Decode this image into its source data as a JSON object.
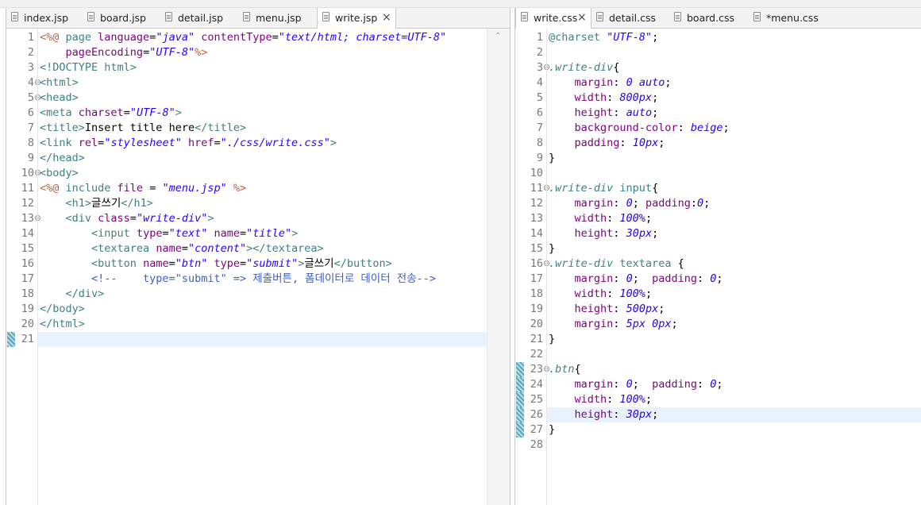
{
  "left": {
    "tabs": [
      {
        "label": "index.jsp",
        "active": false
      },
      {
        "label": "board.jsp",
        "active": false
      },
      {
        "label": "detail.jsp",
        "active": false
      },
      {
        "label": "menu.jsp",
        "active": false
      },
      {
        "label": "write.jsp",
        "active": true,
        "close": "×"
      }
    ],
    "lines": [
      {
        "n": "1",
        "fold": false,
        "segs": [
          [
            "k-jsp",
            "<%@ "
          ],
          [
            "k-tag",
            "page "
          ],
          [
            "k-attr",
            "language"
          ],
          [
            "k-punc",
            "="
          ],
          [
            "k-val",
            "\"java\""
          ],
          [
            "k-punc",
            " "
          ],
          [
            "k-attr",
            "contentType"
          ],
          [
            "k-punc",
            "="
          ],
          [
            "k-val",
            "\"text/html; charset=UTF-8\""
          ]
        ]
      },
      {
        "n": "2",
        "fold": false,
        "segs": [
          [
            "k-punc",
            "    "
          ],
          [
            "k-attr",
            "pageEncoding"
          ],
          [
            "k-punc",
            "="
          ],
          [
            "k-val",
            "\"UTF-8\""
          ],
          [
            "k-jsp",
            "%>"
          ]
        ]
      },
      {
        "n": "3",
        "fold": false,
        "segs": [
          [
            "k-tag",
            "<!DOCTYPE html>"
          ]
        ]
      },
      {
        "n": "4",
        "fold": true,
        "segs": [
          [
            "k-tag",
            "<html>"
          ]
        ]
      },
      {
        "n": "5",
        "fold": true,
        "segs": [
          [
            "k-tag",
            "<head>"
          ]
        ]
      },
      {
        "n": "6",
        "fold": false,
        "segs": [
          [
            "k-tag",
            "<meta "
          ],
          [
            "k-attr",
            "charset"
          ],
          [
            "k-punc",
            "="
          ],
          [
            "k-val",
            "\"UTF-8\""
          ],
          [
            "k-tag",
            ">"
          ]
        ]
      },
      {
        "n": "7",
        "fold": false,
        "segs": [
          [
            "k-tag",
            "<title>"
          ],
          [
            "k-punc",
            "Insert title here"
          ],
          [
            "k-tag",
            "</title>"
          ]
        ]
      },
      {
        "n": "8",
        "fold": false,
        "segs": [
          [
            "k-tag",
            "<link "
          ],
          [
            "k-attr",
            "rel"
          ],
          [
            "k-punc",
            "="
          ],
          [
            "k-val",
            "\"stylesheet\""
          ],
          [
            "k-punc",
            " "
          ],
          [
            "k-attr",
            "href"
          ],
          [
            "k-punc",
            "="
          ],
          [
            "k-val",
            "\"./css/write.css\""
          ],
          [
            "k-tag",
            ">"
          ]
        ]
      },
      {
        "n": "9",
        "fold": false,
        "segs": [
          [
            "k-tag",
            "</head>"
          ]
        ]
      },
      {
        "n": "10",
        "fold": true,
        "segs": [
          [
            "k-tag",
            "<body>"
          ]
        ]
      },
      {
        "n": "11",
        "fold": false,
        "segs": [
          [
            "k-jsp",
            "<%@ "
          ],
          [
            "k-tag",
            "include "
          ],
          [
            "k-attr",
            "file"
          ],
          [
            "k-punc",
            " = "
          ],
          [
            "k-val",
            "\"menu.jsp\""
          ],
          [
            "k-punc",
            " "
          ],
          [
            "k-jsp",
            "%>"
          ]
        ]
      },
      {
        "n": "12",
        "fold": false,
        "segs": [
          [
            "k-punc",
            "    "
          ],
          [
            "k-tag",
            "<h1>"
          ],
          [
            "k-punc",
            "글쓰기"
          ],
          [
            "k-tag",
            "</h1>"
          ]
        ]
      },
      {
        "n": "13",
        "fold": true,
        "segs": [
          [
            "k-punc",
            "    "
          ],
          [
            "k-tag",
            "<div "
          ],
          [
            "k-attr",
            "class"
          ],
          [
            "k-punc",
            "="
          ],
          [
            "k-val",
            "\"write-div\""
          ],
          [
            "k-tag",
            ">"
          ]
        ]
      },
      {
        "n": "14",
        "fold": false,
        "segs": [
          [
            "k-punc",
            "        "
          ],
          [
            "k-tag",
            "<input "
          ],
          [
            "k-attr",
            "type"
          ],
          [
            "k-punc",
            "="
          ],
          [
            "k-val",
            "\"text\""
          ],
          [
            "k-punc",
            " "
          ],
          [
            "k-attr",
            "name"
          ],
          [
            "k-punc",
            "="
          ],
          [
            "k-val",
            "\"title\""
          ],
          [
            "k-tag",
            ">"
          ]
        ]
      },
      {
        "n": "15",
        "fold": false,
        "segs": [
          [
            "k-punc",
            "        "
          ],
          [
            "k-tag",
            "<textarea "
          ],
          [
            "k-attr",
            "name"
          ],
          [
            "k-punc",
            "="
          ],
          [
            "k-val",
            "\"content\""
          ],
          [
            "k-tag",
            "></textarea>"
          ]
        ]
      },
      {
        "n": "16",
        "fold": false,
        "segs": [
          [
            "k-punc",
            "        "
          ],
          [
            "k-tag",
            "<button "
          ],
          [
            "k-attr",
            "name"
          ],
          [
            "k-punc",
            "="
          ],
          [
            "k-val",
            "\"btn\""
          ],
          [
            "k-punc",
            " "
          ],
          [
            "k-attr",
            "type"
          ],
          [
            "k-punc",
            "="
          ],
          [
            "k-val",
            "\"submit\""
          ],
          [
            "k-tag",
            ">"
          ],
          [
            "k-punc",
            "글쓰기"
          ],
          [
            "k-tag",
            "</button>"
          ]
        ]
      },
      {
        "n": "17",
        "fold": false,
        "segs": [
          [
            "k-punc",
            "        "
          ],
          [
            "k-cmt",
            "<!--    type=\"submit\" => 제출버튼, 폼데이터로 데이터 전송-->"
          ]
        ]
      },
      {
        "n": "18",
        "fold": false,
        "segs": [
          [
            "k-punc",
            "    "
          ],
          [
            "k-tag",
            "</div>"
          ]
        ]
      },
      {
        "n": "19",
        "fold": false,
        "segs": [
          [
            "k-tag",
            "</body>"
          ]
        ]
      },
      {
        "n": "20",
        "fold": false,
        "segs": [
          [
            "k-tag",
            "</html>"
          ]
        ]
      },
      {
        "n": "21",
        "fold": false,
        "segs": []
      }
    ]
  },
  "right": {
    "tabs": [
      {
        "label": "write.css",
        "active": true,
        "close": "×"
      },
      {
        "label": "detail.css",
        "active": false
      },
      {
        "label": "board.css",
        "active": false
      },
      {
        "label": "*menu.css",
        "active": false
      }
    ],
    "lines": [
      {
        "n": "1",
        "fold": false,
        "segs": [
          [
            "k-at",
            "@charset "
          ],
          [
            "k-str",
            "\"UTF-8\""
          ],
          [
            "k-punc",
            ";"
          ]
        ]
      },
      {
        "n": "2",
        "fold": false,
        "segs": []
      },
      {
        "n": "3",
        "fold": true,
        "segs": [
          [
            "k-sel",
            ".write-div"
          ],
          [
            "k-punc",
            "{"
          ]
        ]
      },
      {
        "n": "4",
        "fold": false,
        "segs": [
          [
            "k-punc",
            "    "
          ],
          [
            "k-prop",
            "margin"
          ],
          [
            "k-punc",
            ": "
          ],
          [
            "k-cval",
            "0 auto"
          ],
          [
            "k-punc",
            ";"
          ]
        ]
      },
      {
        "n": "5",
        "fold": false,
        "segs": [
          [
            "k-punc",
            "    "
          ],
          [
            "k-prop",
            "width"
          ],
          [
            "k-punc",
            ": "
          ],
          [
            "k-cval",
            "800px"
          ],
          [
            "k-punc",
            ";"
          ]
        ]
      },
      {
        "n": "6",
        "fold": false,
        "segs": [
          [
            "k-punc",
            "    "
          ],
          [
            "k-prop",
            "height"
          ],
          [
            "k-punc",
            ": "
          ],
          [
            "k-cval",
            "auto"
          ],
          [
            "k-punc",
            ";"
          ]
        ]
      },
      {
        "n": "7",
        "fold": false,
        "segs": [
          [
            "k-punc",
            "    "
          ],
          [
            "k-prop",
            "background-color"
          ],
          [
            "k-punc",
            ": "
          ],
          [
            "k-cval",
            "beige"
          ],
          [
            "k-punc",
            ";"
          ]
        ]
      },
      {
        "n": "8",
        "fold": false,
        "segs": [
          [
            "k-punc",
            "    "
          ],
          [
            "k-prop",
            "padding"
          ],
          [
            "k-punc",
            ": "
          ],
          [
            "k-cval",
            "10px"
          ],
          [
            "k-punc",
            ";"
          ]
        ]
      },
      {
        "n": "9",
        "fold": false,
        "segs": [
          [
            "k-punc",
            "}"
          ]
        ]
      },
      {
        "n": "10",
        "fold": false,
        "segs": []
      },
      {
        "n": "11",
        "fold": true,
        "segs": [
          [
            "k-sel",
            ".write-div"
          ],
          [
            "k-punc",
            " "
          ],
          [
            "k-selplain",
            "input"
          ],
          [
            "k-punc",
            "{"
          ]
        ]
      },
      {
        "n": "12",
        "fold": false,
        "segs": [
          [
            "k-punc",
            "    "
          ],
          [
            "k-prop",
            "margin"
          ],
          [
            "k-punc",
            ": "
          ],
          [
            "k-cval",
            "0"
          ],
          [
            "k-punc",
            "; "
          ],
          [
            "k-prop",
            "padding"
          ],
          [
            "k-punc",
            ":"
          ],
          [
            "k-cval",
            "0"
          ],
          [
            "k-punc",
            ";"
          ]
        ]
      },
      {
        "n": "13",
        "fold": false,
        "segs": [
          [
            "k-punc",
            "    "
          ],
          [
            "k-prop",
            "width"
          ],
          [
            "k-punc",
            ": "
          ],
          [
            "k-cval",
            "100%"
          ],
          [
            "k-punc",
            ";"
          ]
        ]
      },
      {
        "n": "14",
        "fold": false,
        "segs": [
          [
            "k-punc",
            "    "
          ],
          [
            "k-prop",
            "height"
          ],
          [
            "k-punc",
            ": "
          ],
          [
            "k-cval",
            "30px"
          ],
          [
            "k-punc",
            ";"
          ]
        ]
      },
      {
        "n": "15",
        "fold": false,
        "segs": [
          [
            "k-punc",
            "}"
          ]
        ]
      },
      {
        "n": "16",
        "fold": true,
        "segs": [
          [
            "k-sel",
            ".write-div"
          ],
          [
            "k-punc",
            " "
          ],
          [
            "k-selplain",
            "textarea"
          ],
          [
            "k-punc",
            " {"
          ]
        ]
      },
      {
        "n": "17",
        "fold": false,
        "segs": [
          [
            "k-punc",
            "    "
          ],
          [
            "k-prop",
            "margin"
          ],
          [
            "k-punc",
            ": "
          ],
          [
            "k-cval",
            "0"
          ],
          [
            "k-punc",
            ";  "
          ],
          [
            "k-prop",
            "padding"
          ],
          [
            "k-punc",
            ": "
          ],
          [
            "k-cval",
            "0"
          ],
          [
            "k-punc",
            ";"
          ]
        ]
      },
      {
        "n": "18",
        "fold": false,
        "segs": [
          [
            "k-punc",
            "    "
          ],
          [
            "k-prop",
            "width"
          ],
          [
            "k-punc",
            ": "
          ],
          [
            "k-cval",
            "100%"
          ],
          [
            "k-punc",
            ";"
          ]
        ]
      },
      {
        "n": "19",
        "fold": false,
        "segs": [
          [
            "k-punc",
            "    "
          ],
          [
            "k-prop",
            "height"
          ],
          [
            "k-punc",
            ": "
          ],
          [
            "k-cval",
            "500px"
          ],
          [
            "k-punc",
            ";"
          ]
        ]
      },
      {
        "n": "20",
        "fold": false,
        "segs": [
          [
            "k-punc",
            "    "
          ],
          [
            "k-prop",
            "margin"
          ],
          [
            "k-punc",
            ": "
          ],
          [
            "k-cval",
            "5px 0px"
          ],
          [
            "k-punc",
            ";"
          ]
        ]
      },
      {
        "n": "21",
        "fold": false,
        "segs": [
          [
            "k-punc",
            "}"
          ]
        ]
      },
      {
        "n": "22",
        "fold": false,
        "segs": []
      },
      {
        "n": "23",
        "fold": true,
        "segs": [
          [
            "k-sel",
            ".btn"
          ],
          [
            "k-punc",
            "{"
          ]
        ]
      },
      {
        "n": "24",
        "fold": false,
        "segs": [
          [
            "k-punc",
            "    "
          ],
          [
            "k-prop",
            "margin"
          ],
          [
            "k-punc",
            ": "
          ],
          [
            "k-cval",
            "0"
          ],
          [
            "k-punc",
            ";  "
          ],
          [
            "k-prop",
            "padding"
          ],
          [
            "k-punc",
            ": "
          ],
          [
            "k-cval",
            "0"
          ],
          [
            "k-punc",
            ";"
          ]
        ]
      },
      {
        "n": "25",
        "fold": false,
        "segs": [
          [
            "k-punc",
            "    "
          ],
          [
            "k-prop",
            "width"
          ],
          [
            "k-punc",
            ": "
          ],
          [
            "k-cval",
            "100%"
          ],
          [
            "k-punc",
            ";"
          ]
        ]
      },
      {
        "n": "26",
        "fold": false,
        "segs": [
          [
            "k-punc",
            "    "
          ],
          [
            "k-prop",
            "height"
          ],
          [
            "k-punc",
            ": "
          ],
          [
            "k-cval",
            "30px"
          ],
          [
            "k-punc",
            ";"
          ]
        ]
      },
      {
        "n": "27",
        "fold": false,
        "segs": [
          [
            "k-punc",
            "}"
          ]
        ]
      },
      {
        "n": "28",
        "fold": false,
        "segs": []
      }
    ]
  }
}
